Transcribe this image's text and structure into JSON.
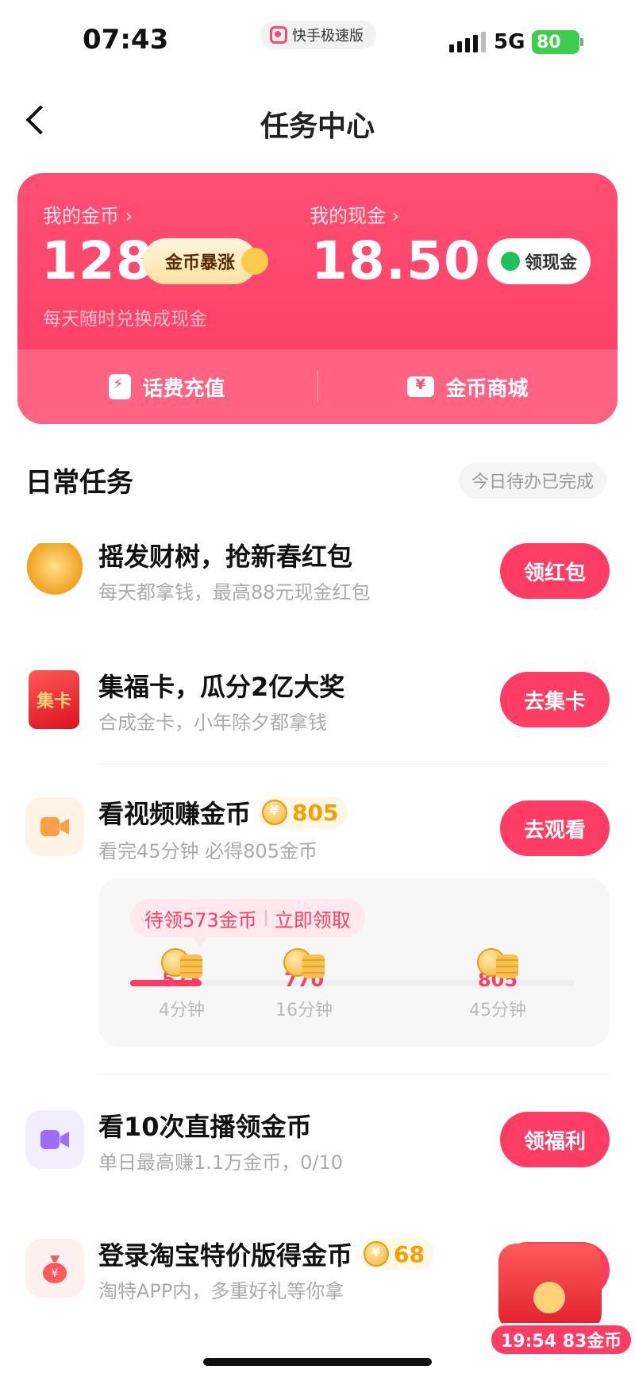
{
  "status_bar": {
    "time": "07:43",
    "app_name": "快手极速版",
    "network": "5G",
    "battery": "80"
  },
  "header": {
    "title": "任务中心"
  },
  "wallet": {
    "coins_label": "我的金币 ›",
    "coins_value": "128",
    "coins_badge": "金币暴涨",
    "cash_label": "我的现金 ›",
    "cash_value": "18.50",
    "cash_button": "领现金",
    "subtitle": "每天随时兑换成现金",
    "links": [
      {
        "label": "话费充值",
        "icon": "bolt-icon"
      },
      {
        "label": "金币商城",
        "icon": "ticket-icon"
      }
    ]
  },
  "daily": {
    "title": "日常任务",
    "tag": "今日待办已完成",
    "tasks": [
      {
        "title": "摇发财树，抢新春红包",
        "desc": "每天都拿钱，最高88元现金红包",
        "button": "领红包",
        "icon": "money-tree-icon"
      },
      {
        "title": "集福卡，瓜分2亿大奖",
        "desc": "合成金卡，小年除夕都拿钱",
        "button": "去集卡",
        "icon": "fu-card-icon",
        "icon_text": "集卡"
      },
      {
        "title": "看视频赚金币",
        "coins": "805",
        "desc": "看完45分钟 必得805金币",
        "button": "去观看",
        "icon": "video-camera-icon"
      },
      {
        "title": "看10次直播领金币",
        "desc": "单日最高赚1.1万金币，0/10",
        "button": "领福利",
        "icon": "live-camera-icon"
      },
      {
        "title": "登录淘宝特价版得金币",
        "coins": "68",
        "desc": "淘特APP内，多重好礼等你拿",
        "button": "",
        "icon": "money-bag-icon"
      }
    ]
  },
  "video_progress": {
    "tip_left": "待领573金币",
    "tip_right": "立即领取",
    "progress": 0.16,
    "milestones": [
      {
        "amount": "573",
        "time": "4分钟"
      },
      {
        "amount": "770",
        "time": "16分钟"
      },
      {
        "amount": "805",
        "time": "45分钟"
      }
    ]
  },
  "float_badge": {
    "text": "19:54 83金币"
  },
  "colors": {
    "accent": "#ff3c64",
    "gold": "#ff9a00"
  }
}
